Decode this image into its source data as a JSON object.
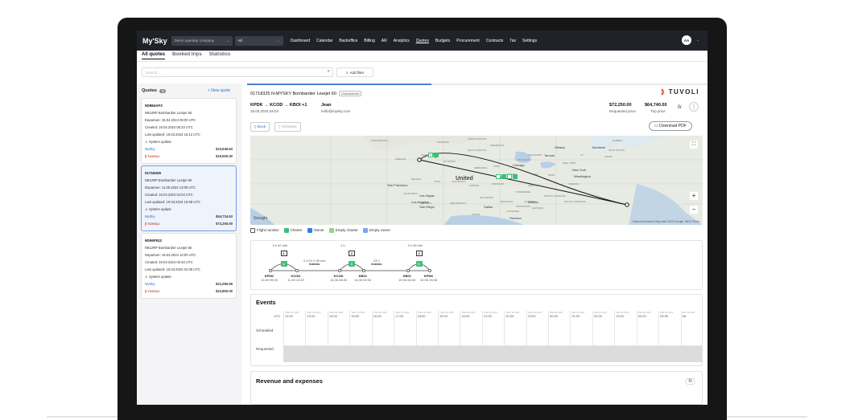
{
  "nav": {
    "logo": "My'Sky",
    "company_select": "Demo operator company",
    "all_select": "All",
    "items": [
      "Dashboard",
      "Calendar",
      "Backoffice",
      "Billing",
      "AR",
      "Analytics",
      "Quotes",
      "Budgets",
      "Procurement",
      "Contracts",
      "Tax",
      "Settings"
    ],
    "active_index": 6,
    "avatar": "AA"
  },
  "tabs": [
    "All quotes",
    "Booked trips",
    "Statistics"
  ],
  "search": {
    "placeholder": "Search..."
  },
  "filter": {
    "label": "Add filter"
  },
  "quotes_panel": {
    "title": "Quotes",
    "count": "3",
    "new_quote": "+ New quote",
    "cards": [
      {
        "id": "5D984AF3",
        "aircraft": "N812RP Bombardier Learjet 60",
        "departure": "Departure: 15.04.2024 09:00 UTC",
        "created": "Created: 19.03.2024 06:33 UTC",
        "updated": "Last updated: 19.03.2024 16:12 UTC",
        "user": "System update",
        "mysky_price": "$23,946.63",
        "tuvoli_price": "$19,550.00",
        "mysky": "MySky",
        "tuvoli": "TUVOLI"
      },
      {
        "id": "01718325",
        "aircraft": "N812RP Bombardier Learjet 60",
        "departure": "Departure: 11.06.2024 13:00 UTC",
        "created": "Created: 19.03.2024 04:04 UTC",
        "updated": "Last updated: 19.03.2024 19:08 UTC",
        "user": "System update",
        "mysky_price": "$64,734.63",
        "tuvoli_price": "$72,250.00",
        "mysky": "MySky",
        "tuvoli": "TUVOLI"
      },
      {
        "id": "9D06F812",
        "aircraft": "N812RP Bombardier Learjet 60",
        "departure": "Departure: 19.03.2024 12:00 UTC",
        "created": "Created: 19.03.2024 03:46 UTC",
        "updated": "Last updated: 19.03.2024 04:35 UTC",
        "user": "System update",
        "mysky_price": "$21,065.59",
        "tuvoli_price": "$24,850.00",
        "mysky": "MySky",
        "tuvoli": "TUVOLI"
      }
    ]
  },
  "detail": {
    "header": "01718325 N-MYSKY Bombardier Learjet 60",
    "status": "Unanswered",
    "brand": "TUVOLI",
    "route": "KPDK → KCOD → KBOI +1",
    "route_date": "19.03.2024 04:04",
    "passenger": "Jean",
    "email": "hello@mysky.com",
    "requested_price": "$72,250.00",
    "requested_label": "Requested price",
    "trip_price": "$64,740.00",
    "trip_label": "Trip price",
    "book": "Book",
    "schedule": "Schedule",
    "download": "Download PDF",
    "fx": "fx",
    "more": "⋮"
  },
  "map": {
    "labels": [
      "WASHINGTON",
      "MONTANA",
      "NORTH DAKOTA",
      "MINNESOTA",
      "OREGON",
      "IDAHO",
      "WYOMING",
      "SOUTH DAKOTA",
      "WISCONSIN",
      "MICHIGAN",
      "Ottawa",
      "Montreal",
      "NEVADA",
      "UTAH",
      "COLORADO",
      "NEBRASKA",
      "IOWA",
      "Chicago",
      "Toronto",
      "NEW YORK",
      "San Francisco",
      "United",
      "KANSAS",
      "MISSOURI",
      "ILLINOIS",
      "OHIO",
      "PENN",
      "Washington",
      "New York",
      "CALIFORNIA",
      "Las Vegas",
      "ARIZONA",
      "NEW MEXICO",
      "OKLAHOMA",
      "ARKANSAS",
      "TENNESSEE",
      "Los Angeles",
      "San Diego",
      "Dallas",
      "Atlanta",
      "TEXAS",
      "LOUISIANA",
      "GEORGIA",
      "NORTH CAROLINA",
      "Houston",
      "NOVA SCOTIA",
      "QUEBEC",
      "MAINE",
      "VT",
      "KENTUCKY",
      "ALABAMA",
      "SOUTH CAROLINA",
      "MISSISSIPPI",
      "VIRGINIA"
    ],
    "google": "Google",
    "attribution": "Keyboard shortcuts   Map data ©2024 Google, INEGI   Terms",
    "zoom_in": "+",
    "zoom_out": "−",
    "fullscreen": "⛶"
  },
  "legend": [
    {
      "label": "Flight number",
      "color": "#ffffff"
    },
    {
      "label": "Charter",
      "color": "#3cbf7a"
    },
    {
      "label": "Owner",
      "color": "#3b7be0"
    },
    {
      "label": "Empty charter",
      "color": "#8fd48a"
    },
    {
      "label": "Empty owner",
      "color": "#7aa8ee"
    }
  ],
  "timeline": {
    "legs": [
      {
        "duration": "3 h 40 min",
        "num": "1",
        "from": "KPDK",
        "from_time": "11.06 09:00",
        "to": "KCOD",
        "to_time": "11.06 13:40"
      },
      {
        "duration": "1 h",
        "num": "2",
        "from": "KCOD",
        "from_time": "14.06 08:30",
        "to": "KBOI",
        "to_time": "14.06 09:30"
      },
      {
        "duration": "3 h 38 min",
        "num": "3",
        "from": "KBOI",
        "from_time": "15.06 08:30",
        "to": "KPDK",
        "to_time": "15.06 16:08"
      }
    ],
    "gaps": [
      {
        "label": "2 d 21 h 50 min",
        "sub": "PARKING"
      },
      {
        "label": "23 h",
        "sub": "PARKING"
      }
    ]
  },
  "events": {
    "title": "Events",
    "tz": "UTC",
    "rows": [
      "Scheduled",
      "Requested"
    ],
    "columns": [
      {
        "day": "THU 15 JUN",
        "time": "12:00"
      },
      {
        "day": "THU 15 JUN",
        "time": "13:00"
      },
      {
        "day": "THU 15 JUN",
        "time": "14:00"
      },
      {
        "day": "THU 15 JUN",
        "time": "15:00"
      },
      {
        "day": "THU 15 JUN",
        "time": "16:00"
      },
      {
        "day": "THU 15 JUN",
        "time": "17:00"
      },
      {
        "day": "THU 15 JUN",
        "time": "18:00"
      },
      {
        "day": "THU 15 JUN",
        "time": "19:00"
      },
      {
        "day": "THU 15 JUN",
        "time": "20:00"
      },
      {
        "day": "THU 15 JUN",
        "time": "21:00"
      },
      {
        "day": "THU 15 JUN",
        "time": "22:00"
      },
      {
        "day": "THU 15 JUN",
        "time": "23:00"
      },
      {
        "day": "FRI 16 JUN",
        "time": "00:00"
      },
      {
        "day": "FRI 16 JUN",
        "time": "01:00"
      },
      {
        "day": "FRI 16 JUN",
        "time": "02:00"
      },
      {
        "day": "FRI 16 JUN",
        "time": "03:00"
      },
      {
        "day": "FRI 16 JUN",
        "time": "04:00"
      },
      {
        "day": "FRI 16 JUN",
        "time": "05:00"
      },
      {
        "day": "FRI 16 JUN",
        "time": "06:"
      }
    ]
  },
  "revenue": {
    "title": "Revenue and expenses",
    "fx": "fx"
  }
}
